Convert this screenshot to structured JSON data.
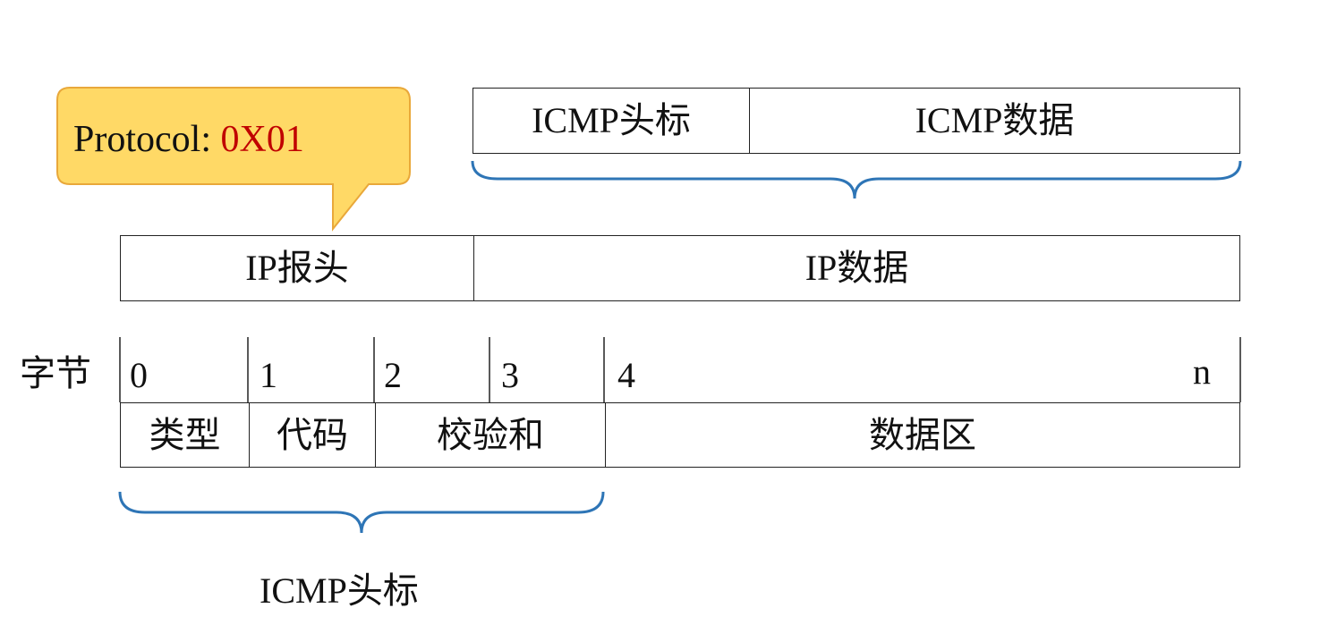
{
  "callout": {
    "label_prefix": "Protocol: ",
    "label_value": "0X01",
    "fill_color": "#FFD966",
    "border_color": "#E9A83A",
    "value_color": "#C00000"
  },
  "icmp_packet": {
    "header": "ICMP头标",
    "data": "ICMP数据"
  },
  "ip_packet": {
    "header": "IP报头",
    "data": "IP数据"
  },
  "byte_row": {
    "label": "字节",
    "offsets": [
      "0",
      "1",
      "2",
      "3",
      "4",
      "n"
    ]
  },
  "fields": {
    "type": "类型",
    "code": "代码",
    "checksum": "校验和",
    "data_area": "数据区"
  },
  "bottom_label": "ICMP头标",
  "brace_color": "#2E75B6"
}
